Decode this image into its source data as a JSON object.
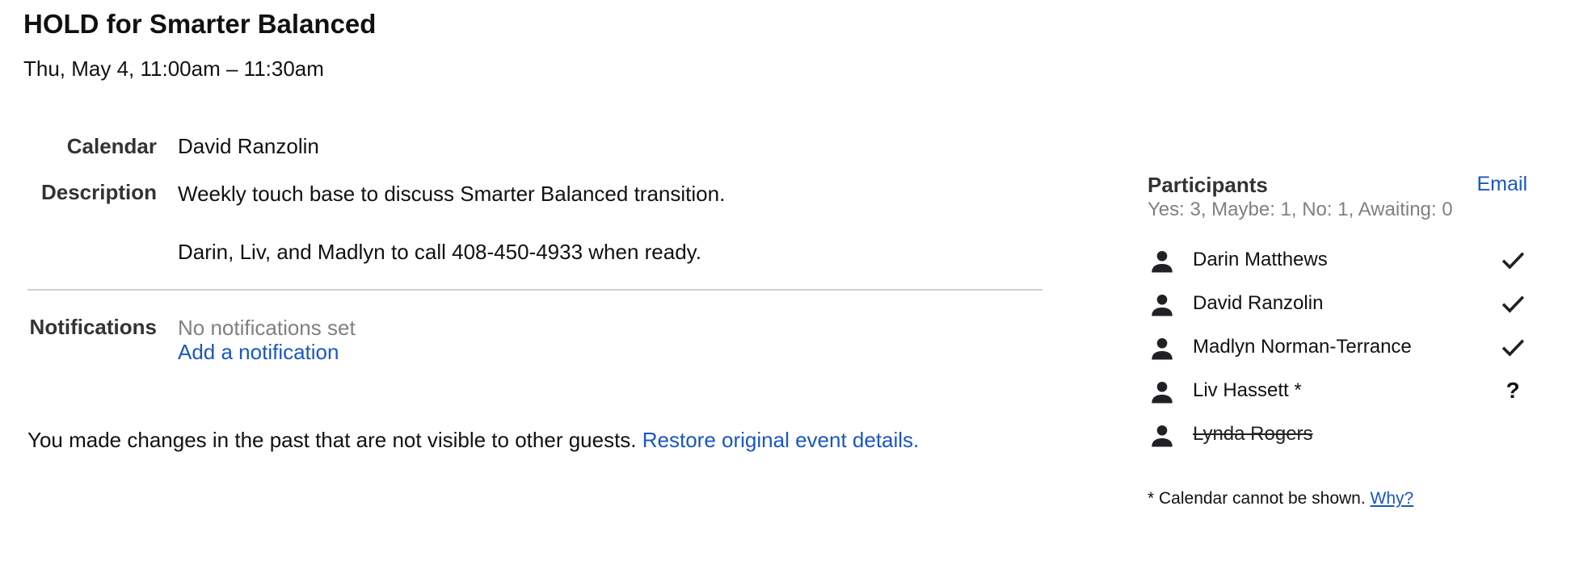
{
  "event": {
    "title": "HOLD for Smarter Balanced",
    "datetime": "Thu, May 4, 11:00am – 11:30am"
  },
  "details": {
    "calendar_label": "Calendar",
    "calendar_value": "David Ranzolin",
    "description_label": "Description",
    "description_line1": "Weekly touch base to discuss Smarter Balanced transition.",
    "description_line2": "Darin, Liv, and Madlyn to call 408-450-4933 when ready.",
    "notifications_label": "Notifications",
    "notifications_status": "No notifications set",
    "add_notification": "Add a notification"
  },
  "changes": {
    "message": "You made changes in the past that are not visible to other guests.",
    "restore_link": "Restore original event details."
  },
  "participants": {
    "title": "Participants",
    "email_link": "Email",
    "summary": "Yes: 3, Maybe: 1, No: 1, Awaiting: 0",
    "list": [
      {
        "name": "Darin Matthews",
        "status": "yes",
        "status_glyph": ""
      },
      {
        "name": "David Ranzolin",
        "status": "yes",
        "status_glyph": ""
      },
      {
        "name": "Madlyn Norman-Terrance",
        "status": "yes",
        "status_glyph": ""
      },
      {
        "name": "Liv Hassett *",
        "status": "maybe",
        "status_glyph": "?"
      },
      {
        "name": "Lynda Rogers",
        "status": "no",
        "status_glyph": ""
      }
    ],
    "footnote_text": "* Calendar cannot be shown.",
    "footnote_link": "Why?"
  },
  "colors": {
    "link": "#1a56c4",
    "muted": "#808080",
    "divider": "#d0d0d0"
  }
}
